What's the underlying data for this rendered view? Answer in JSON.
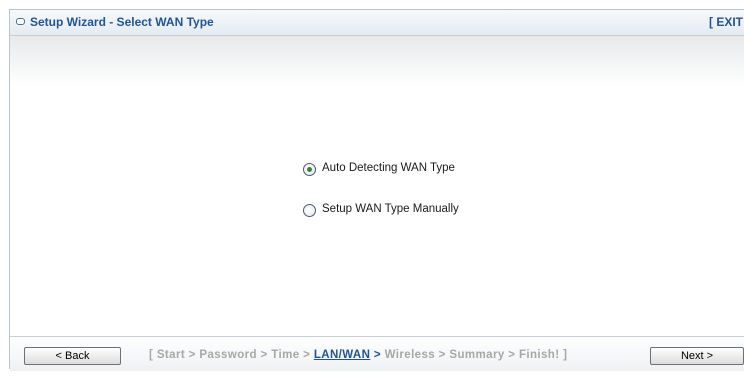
{
  "header": {
    "title": "Setup Wizard - Select WAN Type",
    "exit_label": "[ EXIT"
  },
  "options": [
    {
      "label": "Auto Detecting WAN Type",
      "selected": true
    },
    {
      "label": "Setup WAN Type Manually",
      "selected": false
    }
  ],
  "footer": {
    "back_label": "< Back",
    "next_label": "Next >",
    "steps": {
      "open_bracket": "[",
      "start": "Start",
      "password": "Password",
      "time": "Time",
      "lan_wan": "LAN/WAN",
      "wireless": "Wireless",
      "summary": "Summary",
      "finish": "Finish!",
      "close_bracket": "]",
      "separator": ">"
    }
  },
  "colors": {
    "accent": "#1e5596",
    "inactive_step": "#a7a7a7",
    "radio_selected": "#2f8b2f"
  }
}
